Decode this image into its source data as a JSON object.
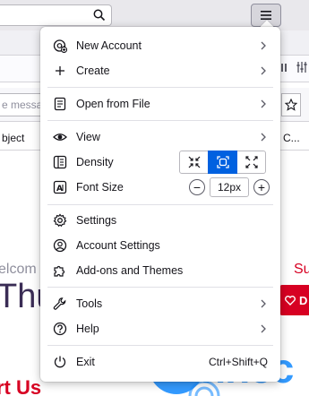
{
  "background": {
    "filter_placeholder": "e messag",
    "column_left": "bject",
    "column_right": "C...",
    "welcome_text": "elcom",
    "heading_fragment": "Thu",
    "red_text": "Su",
    "red_button_label": "D",
    "bottom_text": "rt Us"
  },
  "watermark": {
    "text": "nnec"
  },
  "menu": {
    "new_account": "New Account",
    "create": "Create",
    "open_from_file": "Open from File",
    "view": "View",
    "density": "Density",
    "font_size": "Font Size",
    "font_size_value": "12px",
    "font_decrease": "−",
    "font_increase": "+",
    "settings": "Settings",
    "account_settings": "Account Settings",
    "addons_themes": "Add-ons and Themes",
    "tools": "Tools",
    "help": "Help",
    "exit": "Exit",
    "exit_shortcut": "Ctrl+Shift+Q"
  },
  "colors": {
    "accent": "#0061e0",
    "red": "#d70022",
    "watermark": "#1e90ff"
  }
}
